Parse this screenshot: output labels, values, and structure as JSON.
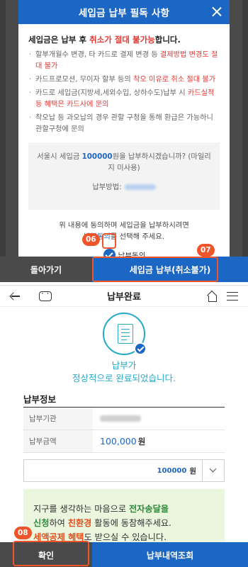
{
  "modal": {
    "title": "세입금 납부 필독 사항",
    "lead_prefix": "세입금은 납부 후 ",
    "lead_red": "취소가 절대 불가능",
    "lead_suffix": "합니다.",
    "notices": [
      {
        "normal": "할부개월수 변경, 타 카드로 결제 변경 등 ",
        "red": "결제방법 변경도 절대 불가",
        "after": ""
      },
      {
        "normal": "카드프로모션, 무이자 할부 등의 ",
        "red": "착오 이유로 취소 절대 불가",
        "after": ""
      },
      {
        "normal": "카드로 세입금(지방세,세외수입, 상하수도)납부 시 ",
        "red": "카드실적 등 혜택은 카드사에 문의",
        "after": ""
      },
      {
        "normal": "착오납 등 과오납의 경우 관할 구청을 통해 환급은 가능하니 관할구청에 문의",
        "red": "",
        "after": ""
      }
    ],
    "confirm_prefix": "서울시 세입금 ",
    "confirm_amount": "100000",
    "confirm_suffix": "원을 납부하시겠습니까? (마일리지 미사용)",
    "method_label": "납부방법:",
    "agree_line1": "위 내용에 동의하며 세입금을 납부하시려면",
    "agree_blue": "납부동의",
    "agree_line2_suffix": "를 선택해 주세요.",
    "agree_checkbox_label": "납부동의",
    "back_button": "돌아가기",
    "pay_button": "세입금 납부(취소불가)",
    "badge_06": "06",
    "badge_07": "07"
  },
  "result": {
    "nav_title": "납부완료",
    "done_line1": "납부가",
    "done_line2": "정상적으로 완료되었습니다.",
    "info_title": "납부정보",
    "rows": [
      {
        "key": "납부기관",
        "value": ""
      },
      {
        "key": "납부금액",
        "amount": "100,000",
        "unit": "원"
      }
    ],
    "input_amount": "100000",
    "input_unit": "원",
    "eco_line1_a": "지구를 생각하는 마음으로 ",
    "eco_line1_b": "전자송달을",
    "eco_line2_a": "신청",
    "eco_line2_b": "하여 ",
    "eco_line2_c": "친환경",
    "eco_line2_d": " 활동에 동참해주세요.",
    "eco_line3_a": "세액공제 혜택",
    "eco_line3_b": "도 받으실 수 있습니다.",
    "ok_button": "확인",
    "history_button": "납부내역조회",
    "badge_08": "08"
  }
}
